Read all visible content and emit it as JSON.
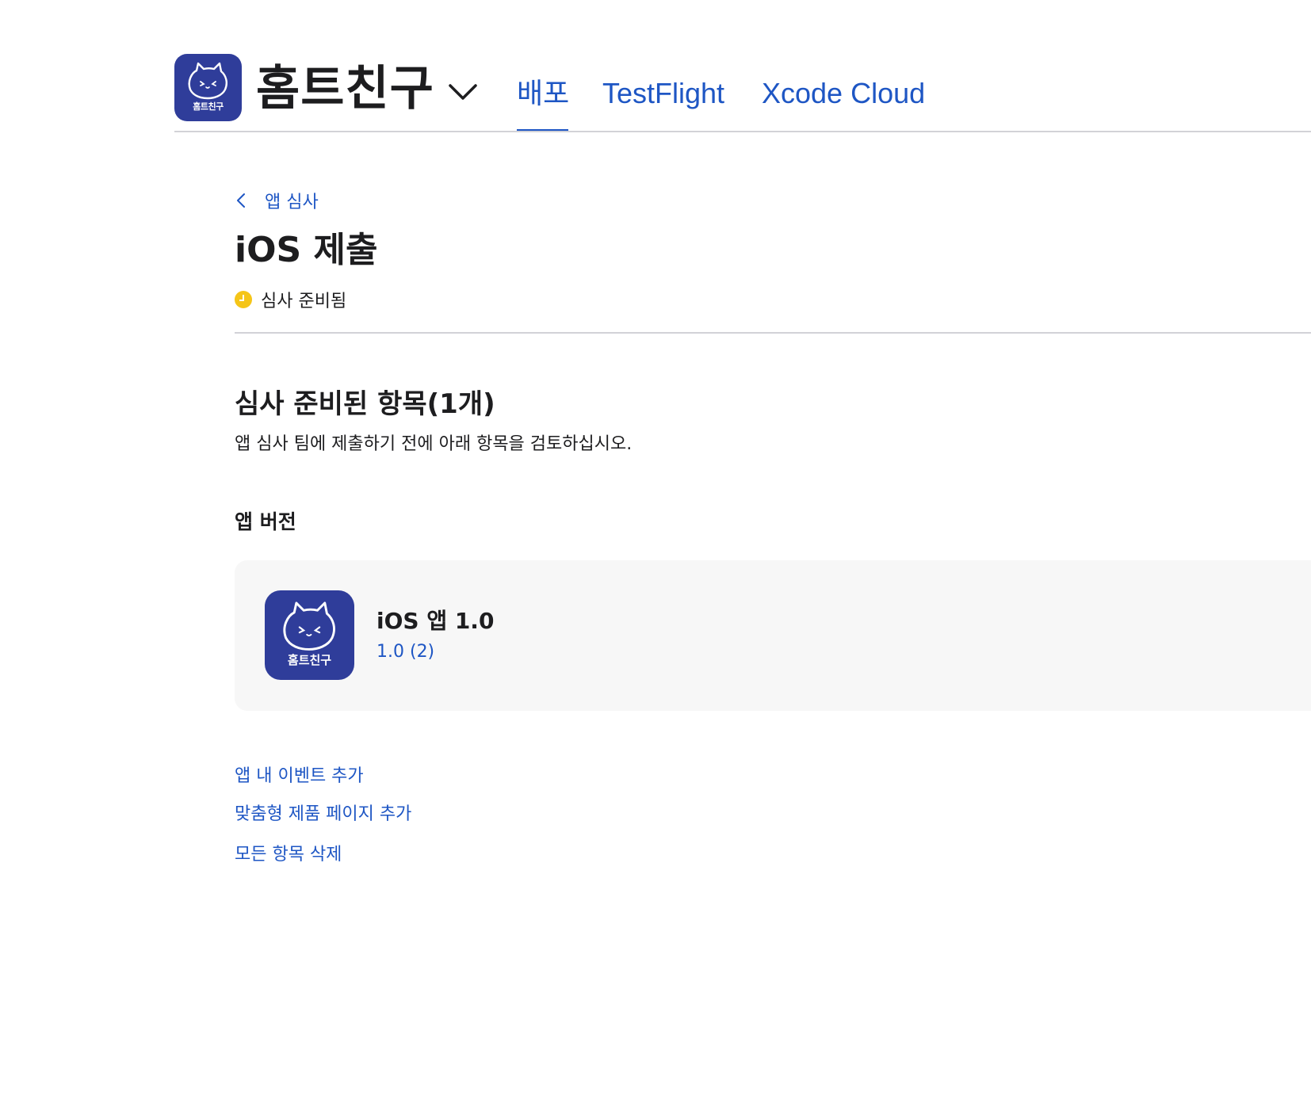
{
  "header": {
    "app_name": "홈트친구",
    "app_icon_text": "홈트친구",
    "tabs": [
      {
        "label": "배포",
        "active": true
      },
      {
        "label": "TestFlight",
        "active": false
      },
      {
        "label": "Xcode Cloud",
        "active": false
      }
    ]
  },
  "breadcrumb": {
    "back_label": "앱 심사"
  },
  "page": {
    "title": "iOS 제출",
    "status": {
      "label": "심사 준비됨",
      "color": "#f5c518",
      "icon": "clock-icon"
    }
  },
  "section": {
    "title": "심사 준비된 항목(1개)",
    "description": "앱 심사 팀에 제출하기 전에 아래 항목을 검토하십시오.",
    "subsection_title": "앱 버전",
    "version_card": {
      "icon_text": "홈트친구",
      "name": "iOS 앱 1.0",
      "build": "1.0 (2)"
    }
  },
  "actions": [
    {
      "label": "앱 내 이벤트 추가"
    },
    {
      "label": "맞춤형 제품 페이지 추가"
    },
    {
      "label": "모든 항목 삭제"
    }
  ],
  "colors": {
    "accent": "#1e56c4",
    "icon_bg": "#2f3d9a",
    "card_bg": "#f7f7f7",
    "divider": "#d2d2d7"
  }
}
